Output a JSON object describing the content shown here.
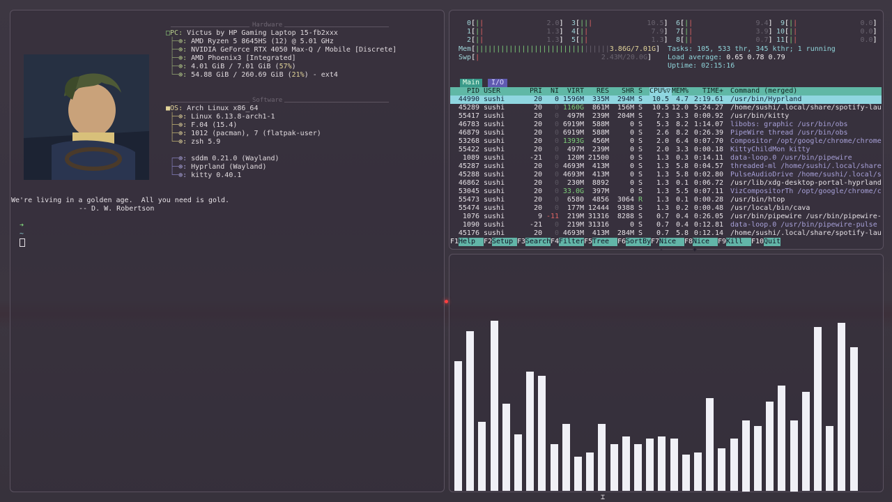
{
  "fastfetch": {
    "hardware_title": "Hardware",
    "software_title": "Software",
    "hw": [
      {
        "key": "PC",
        "value": "Victus by HP Gaming Laptop 15-fb2xxx"
      },
      {
        "key": "⊕",
        "value": "AMD Ryzen 5 8645HS (12) @ 5.01 GHz"
      },
      {
        "key": "⊕",
        "value": "NVIDIA GeForce RTX 4050 Max-Q / Mobile [Discrete]"
      },
      {
        "key": "⊕",
        "value": "AMD Phoenix3 [Integrated]"
      },
      {
        "key": "⊕",
        "value": "4.01 GiB / 7.01 GiB (",
        "pct": "57%",
        "tail": ")"
      },
      {
        "key": "⊕",
        "value": "54.88 GiB / 260.69 GiB (",
        "pct": "21%",
        "tail": ") - ext4"
      }
    ],
    "os": [
      {
        "key": "OS",
        "value": "Arch Linux x86_64"
      },
      {
        "key": "⊕",
        "value": "Linux 6.13.8-arch1-1"
      },
      {
        "key": "⊕",
        "value": "F.04 (15.4)"
      },
      {
        "key": "⊕",
        "value": "1012 (pacman), 7 (flatpak-user)"
      },
      {
        "key": "⊕",
        "value": "zsh 5.9"
      }
    ],
    "de": [
      {
        "key": "⊕",
        "value": "sddm 0.21.0 (Wayland)"
      },
      {
        "key": "⊕",
        "value": "Hyprland (Wayland)"
      },
      {
        "key": "⊕",
        "value": "kitty 0.40.1"
      }
    ]
  },
  "quote": {
    "line1": "We're living in a golden age.  All you need is gold.",
    "line2": "-- D. W. Robertson"
  },
  "prompt": {
    "arrow": "➜",
    "tilde": "~"
  },
  "htop": {
    "cpus": [
      {
        "n": "0",
        "v": "2.0"
      },
      {
        "n": "1",
        "v": "1.3"
      },
      {
        "n": "2",
        "v": "1.3"
      },
      {
        "n": "3",
        "v": "10.5"
      },
      {
        "n": "4",
        "v": "7.9"
      },
      {
        "n": "5",
        "v": "1.3"
      },
      {
        "n": "6",
        "v": "9.4"
      },
      {
        "n": "7",
        "v": "3.9"
      },
      {
        "n": "8",
        "v": "0.7"
      },
      {
        "n": "9",
        "v": "0.0"
      },
      {
        "n": "10",
        "v": "0.0"
      },
      {
        "n": "11",
        "v": "0.0"
      }
    ],
    "mem_label": "Mem",
    "mem_value": "3.86G/7.01G",
    "swp_label": "Swp",
    "swp_value": "2.43M/20.0G",
    "tasks": "Tasks: 105, 533 thr, 345 kthr; 1 running",
    "load": "Load average: ",
    "load_vals": "0.65 0.78 0.79",
    "uptime": "Uptime: 02:15:16",
    "tab_main": "Main",
    "tab_io": "I/O",
    "headers": {
      "pid": "PID",
      "user": "USER",
      "pri": "PRI",
      "ni": "NI",
      "virt": "VIRT",
      "res": "RES",
      "shr": "SHR",
      "s": "S",
      "cpu": "CPU%▽",
      "mem": "MEM%",
      "time": "TIME+",
      "cmd": "Command (merged)"
    },
    "rows": [
      {
        "pid": "44990",
        "user": "sushi",
        "pri": "20",
        "ni": "0",
        "virt": "1596M",
        "res": "335M",
        "shr": "294M",
        "s": "S",
        "cpu": "10.5",
        "mem": "4.7",
        "time": "2:19.61",
        "cmd": "/usr/bin/Hyprland"
      },
      {
        "pid": "45289",
        "user": "sushi",
        "pri": "20",
        "ni": "0",
        "virt": "1160G",
        "res": "861M",
        "shr": "156M",
        "s": "S",
        "cpu": "10.5",
        "mem": "12.0",
        "time": "5:24.27",
        "cmd": "/home/sushi/.local/share/spotify-lau"
      },
      {
        "pid": "55417",
        "user": "sushi",
        "pri": "20",
        "ni": "0",
        "virt": "497M",
        "res": "239M",
        "shr": "204M",
        "s": "S",
        "cpu": "7.3",
        "mem": "3.3",
        "time": "0:00.92",
        "cmd": "/usr/bin/kitty"
      },
      {
        "pid": "46783",
        "user": "sushi",
        "pri": "20",
        "ni": "0",
        "virt": "6919M",
        "res": "588M",
        "shr": "0",
        "s": "S",
        "cpu": "5.3",
        "mem": "8.2",
        "time": "1:14.07",
        "cmd": "libobs: graphic /usr/bin/obs"
      },
      {
        "pid": "46879",
        "user": "sushi",
        "pri": "20",
        "ni": "0",
        "virt": "6919M",
        "res": "588M",
        "shr": "0",
        "s": "S",
        "cpu": "2.6",
        "mem": "8.2",
        "time": "0:26.39",
        "cmd": "PipeWire thread /usr/bin/obs"
      },
      {
        "pid": "53268",
        "user": "sushi",
        "pri": "20",
        "ni": "0",
        "virt": "1393G",
        "res": "456M",
        "shr": "0",
        "s": "S",
        "cpu": "2.0",
        "mem": "6.4",
        "time": "0:07.70",
        "cmd": "Compositor /opt/google/chrome/chrome"
      },
      {
        "pid": "55422",
        "user": "sushi",
        "pri": "20",
        "ni": "0",
        "virt": "497M",
        "res": "239M",
        "shr": "0",
        "s": "S",
        "cpu": "2.0",
        "mem": "3.3",
        "time": "0:00.18",
        "cmd": "KittyChildMon kitty"
      },
      {
        "pid": "1089",
        "user": "sushi",
        "pri": "-21",
        "ni": "0",
        "virt": "120M",
        "res": "21500",
        "shr": "0",
        "s": "S",
        "cpu": "1.3",
        "mem": "0.3",
        "time": "0:14.11",
        "cmd": "data-loop.0 /usr/bin/pipewire"
      },
      {
        "pid": "45287",
        "user": "sushi",
        "pri": "20",
        "ni": "0",
        "virt": "4693M",
        "res": "413M",
        "shr": "0",
        "s": "S",
        "cpu": "1.3",
        "mem": "5.8",
        "time": "0:04.57",
        "cmd": "threaded-ml /home/sushi/.local/share"
      },
      {
        "pid": "45288",
        "user": "sushi",
        "pri": "20",
        "ni": "0",
        "virt": "4693M",
        "res": "413M",
        "shr": "0",
        "s": "S",
        "cpu": "1.3",
        "mem": "5.8",
        "time": "0:02.80",
        "cmd": "PulseAudioDrive /home/sushi/.local/s"
      },
      {
        "pid": "46862",
        "user": "sushi",
        "pri": "20",
        "ni": "0",
        "virt": "230M",
        "res": "8892",
        "shr": "0",
        "s": "S",
        "cpu": "1.3",
        "mem": "0.1",
        "time": "0:06.72",
        "cmd": "/usr/lib/xdg-desktop-portal-hyprland"
      },
      {
        "pid": "53045",
        "user": "sushi",
        "pri": "20",
        "ni": "0",
        "virt": "33.0G",
        "res": "397M",
        "shr": "0",
        "s": "S",
        "cpu": "1.3",
        "mem": "5.5",
        "time": "0:07.11",
        "cmd": "VizCompositorTh /opt/google/chrome/c"
      },
      {
        "pid": "55473",
        "user": "sushi",
        "pri": "20",
        "ni": "0",
        "virt": "6580",
        "res": "4856",
        "shr": "3064",
        "s": "R",
        "cpu": "1.3",
        "mem": "0.1",
        "time": "0:00.28",
        "cmd": "/usr/bin/htop"
      },
      {
        "pid": "55474",
        "user": "sushi",
        "pri": "20",
        "ni": "0",
        "virt": "177M",
        "res": "12444",
        "shr": "9388",
        "s": "S",
        "cpu": "1.3",
        "mem": "0.2",
        "time": "0:00.48",
        "cmd": "/usr/local/bin/cava"
      },
      {
        "pid": "1076",
        "user": "sushi",
        "pri": "9",
        "ni": "-11",
        "virt": "219M",
        "res": "31316",
        "shr": "8288",
        "s": "S",
        "cpu": "0.7",
        "mem": "0.4",
        "time": "0:26.05",
        "cmd": "/usr/bin/pipewire /usr/bin/pipewire-"
      },
      {
        "pid": "1090",
        "user": "sushi",
        "pri": "-21",
        "ni": "0",
        "virt": "219M",
        "res": "31316",
        "shr": "0",
        "s": "S",
        "cpu": "0.7",
        "mem": "0.4",
        "time": "0:12.81",
        "cmd": "data-loop.0 /usr/bin/pipewire-pulse"
      },
      {
        "pid": "45176",
        "user": "sushi",
        "pri": "20",
        "ni": "0",
        "virt": "4693M",
        "res": "413M",
        "shr": "284M",
        "s": "S",
        "cpu": "0.7",
        "mem": "5.8",
        "time": "0:12.14",
        "cmd": "/home/sushi/.local/share/spotify-lau"
      }
    ],
    "fkeys": [
      {
        "n": "F1",
        "l": "Help  "
      },
      {
        "n": "F2",
        "l": "Setup "
      },
      {
        "n": "F3",
        "l": "Search"
      },
      {
        "n": "F4",
        "l": "Filter"
      },
      {
        "n": "F5",
        "l": "Tree  "
      },
      {
        "n": "F6",
        "l": "SortBy"
      },
      {
        "n": "F7",
        "l": "Nice -"
      },
      {
        "n": "F8",
        "l": "Nice +"
      },
      {
        "n": "F9",
        "l": "Kill  "
      },
      {
        "n": "F10",
        "l": "Quit"
      }
    ]
  },
  "cava": {
    "bar_color": "#f0f0f6",
    "levels": [
      0.64,
      0.79,
      0.34,
      0.84,
      0.43,
      0.28,
      0.59,
      0.57,
      0.23,
      0.33,
      0.17,
      0.19,
      0.33,
      0.23,
      0.27,
      0.23,
      0.26,
      0.27,
      0.26,
      0.18,
      0.19,
      0.46,
      0.21,
      0.26,
      0.35,
      0.32,
      0.44,
      0.52,
      0.35,
      0.49,
      0.81,
      0.32,
      0.83,
      0.71
    ]
  }
}
